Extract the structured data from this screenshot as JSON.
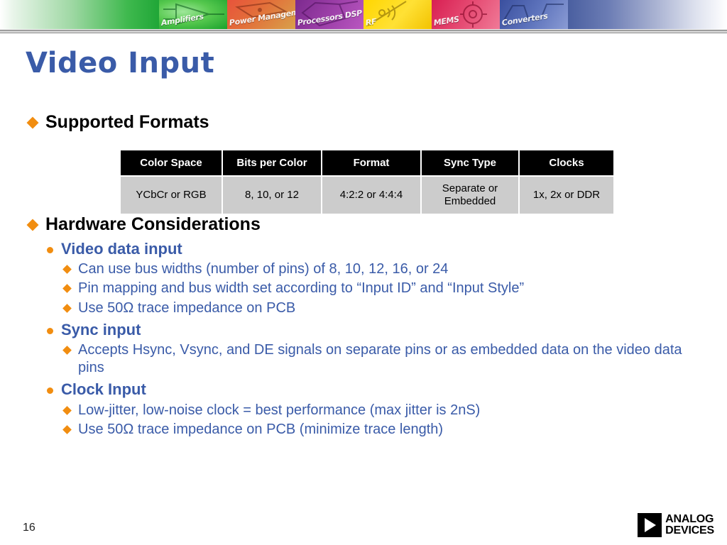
{
  "banner": {
    "tiles": [
      {
        "name": "amplifiers",
        "label": "Amplifiers"
      },
      {
        "name": "power",
        "label": "Power Management"
      },
      {
        "name": "processors",
        "label": "Processors  DSP"
      },
      {
        "name": "rf",
        "label": "RF"
      },
      {
        "name": "mems",
        "label": "MEMS"
      },
      {
        "name": "converters",
        "label": "Converters"
      }
    ]
  },
  "title": "Video Input",
  "colors": {
    "title_blue": "#3a5ba8",
    "bullet_orange": "#f18d10",
    "body_blue": "#3a5ba8",
    "table_header_bg": "#000000",
    "table_row_bg": "#cccccc"
  },
  "sections": {
    "supported_formats": {
      "heading": "Supported Formats"
    },
    "hardware": {
      "heading": "Hardware Considerations",
      "groups": [
        {
          "label": "Video data input",
          "items": [
            "Can use bus widths (number of pins) of 8, 10, 12, 16, or 24",
            "Pin mapping and bus width set according to “Input ID” and “Input Style”",
            "Use 50Ω trace impedance on PCB"
          ]
        },
        {
          "label": "Sync input",
          "items": [
            "Accepts Hsync, Vsync, and DE signals on separate pins or as embedded data on the video data pins"
          ]
        },
        {
          "label": "Clock Input",
          "items": [
            "Low-jitter, low-noise clock = best performance (max jitter is 2nS)",
            "Use 50Ω trace impedance on PCB (minimize trace length)"
          ]
        }
      ]
    }
  },
  "table": {
    "headers": [
      "Color Space",
      "Bits per Color",
      "Format",
      "Sync Type",
      "Clocks"
    ],
    "rows": [
      [
        "YCbCr or RGB",
        "8, 10, or 12",
        "4:2:2 or 4:4:4",
        "Separate or Embedded",
        "1x, 2x or DDR"
      ]
    ]
  },
  "footer": {
    "page_number": "16",
    "logo_line1": "ANALOG",
    "logo_line2": "DEVICES"
  }
}
